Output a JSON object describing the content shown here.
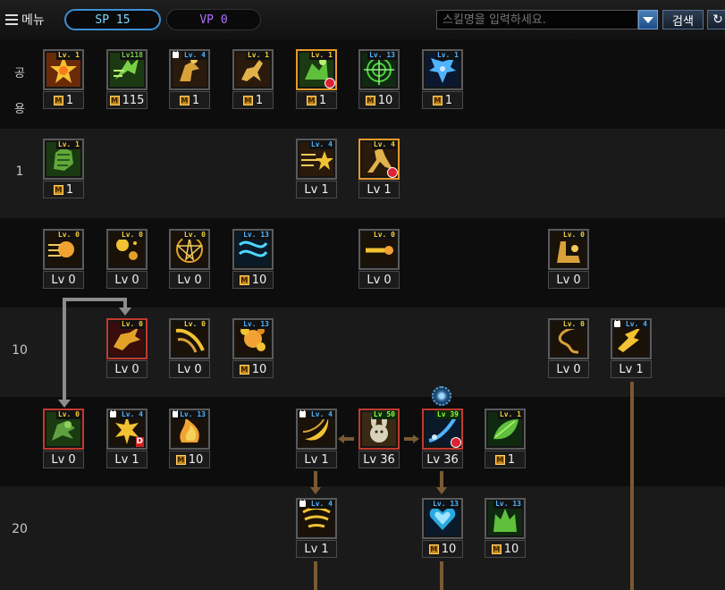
{
  "header": {
    "menu_label": "메뉴",
    "sp_label": "SP 15",
    "vp_label": "VP 0",
    "search_placeholder": "스킬명을 입력하세요.",
    "search_button": "검색"
  },
  "rows": {
    "common_label_1": "공",
    "common_label_2": "용",
    "r1": "1",
    "r10": "10",
    "r20": "20"
  },
  "skills": {
    "c1": {
      "lv": "Lv. 1",
      "foot": "1",
      "type": "m"
    },
    "c2": {
      "lv": "Lv118",
      "foot": "115",
      "type": "m"
    },
    "c3": {
      "lv": "Lv. 4",
      "foot": "1",
      "type": "m"
    },
    "c4": {
      "lv": "Lv. 1",
      "foot": "1",
      "type": "m"
    },
    "c5": {
      "lv": "Lv. 1",
      "foot": "1",
      "type": "m"
    },
    "c6": {
      "lv": "Lv. 13",
      "foot": "10",
      "type": "m"
    },
    "c7": {
      "lv": "Lv. 1",
      "foot": "1",
      "type": "m"
    },
    "s1a": {
      "lv": "Lv. 1",
      "foot": "1",
      "type": "m"
    },
    "s1b": {
      "lv": "Lv. 4",
      "foot": "Lv 1",
      "type": "lv"
    },
    "s1c": {
      "lv": "Lv. 4",
      "foot": "Lv 1",
      "type": "lv"
    },
    "s5a": {
      "lv": "Lv. 0",
      "foot": "Lv 0",
      "type": "lv"
    },
    "s5b": {
      "lv": "Lv. 0",
      "foot": "Lv 0",
      "type": "lv"
    },
    "s5c": {
      "lv": "Lv. 0",
      "foot": "Lv 0",
      "type": "lv"
    },
    "s5d": {
      "lv": "Lv. 13",
      "foot": "10",
      "type": "m"
    },
    "s5e": {
      "lv": "Lv. 0",
      "foot": "Lv 0",
      "type": "lv"
    },
    "s5f": {
      "lv": "Lv. 0",
      "foot": "Lv 0",
      "type": "lv"
    },
    "s10a": {
      "lv": "Lv. 0",
      "foot": "Lv 0",
      "type": "lv"
    },
    "s10b": {
      "lv": "Lv. 0",
      "foot": "Lv 0",
      "type": "lv"
    },
    "s10c": {
      "lv": "Lv. 13",
      "foot": "10",
      "type": "m"
    },
    "s10d": {
      "lv": "Lv. 0",
      "foot": "Lv 0",
      "type": "lv"
    },
    "s10e": {
      "lv": "Lv. 4",
      "foot": "Lv 1",
      "type": "lv"
    },
    "s15a": {
      "lv": "Lv. 0",
      "foot": "Lv 0",
      "type": "lv"
    },
    "s15b": {
      "lv": "Lv. 4",
      "foot": "Lv 1",
      "type": "lv"
    },
    "s15c": {
      "lv": "Lv. 13",
      "foot": "10",
      "type": "m"
    },
    "s15d": {
      "lv": "Lv. 4",
      "foot": "Lv 1",
      "type": "lv"
    },
    "s15e": {
      "lv": "Lv 50",
      "foot": "Lv 36",
      "type": "lv"
    },
    "s15f": {
      "lv": "Lv 39",
      "foot": "Lv 36",
      "type": "lv"
    },
    "s15g": {
      "lv": "Lv. 1",
      "foot": "1",
      "type": "m"
    },
    "s20a": {
      "lv": "Lv. 4",
      "foot": "Lv 1",
      "type": "lv"
    },
    "s20b": {
      "lv": "Lv. 13",
      "foot": "10",
      "type": "m"
    },
    "s20c": {
      "lv": "Lv. 13",
      "foot": "10",
      "type": "m"
    }
  },
  "badges": {
    "m": "M",
    "d": "D"
  },
  "colors": {
    "accent_blue": "#3c8fd4",
    "vp_purple": "#b070ff",
    "gold": "#e5b52a",
    "link_brown": "#7a5a34"
  }
}
